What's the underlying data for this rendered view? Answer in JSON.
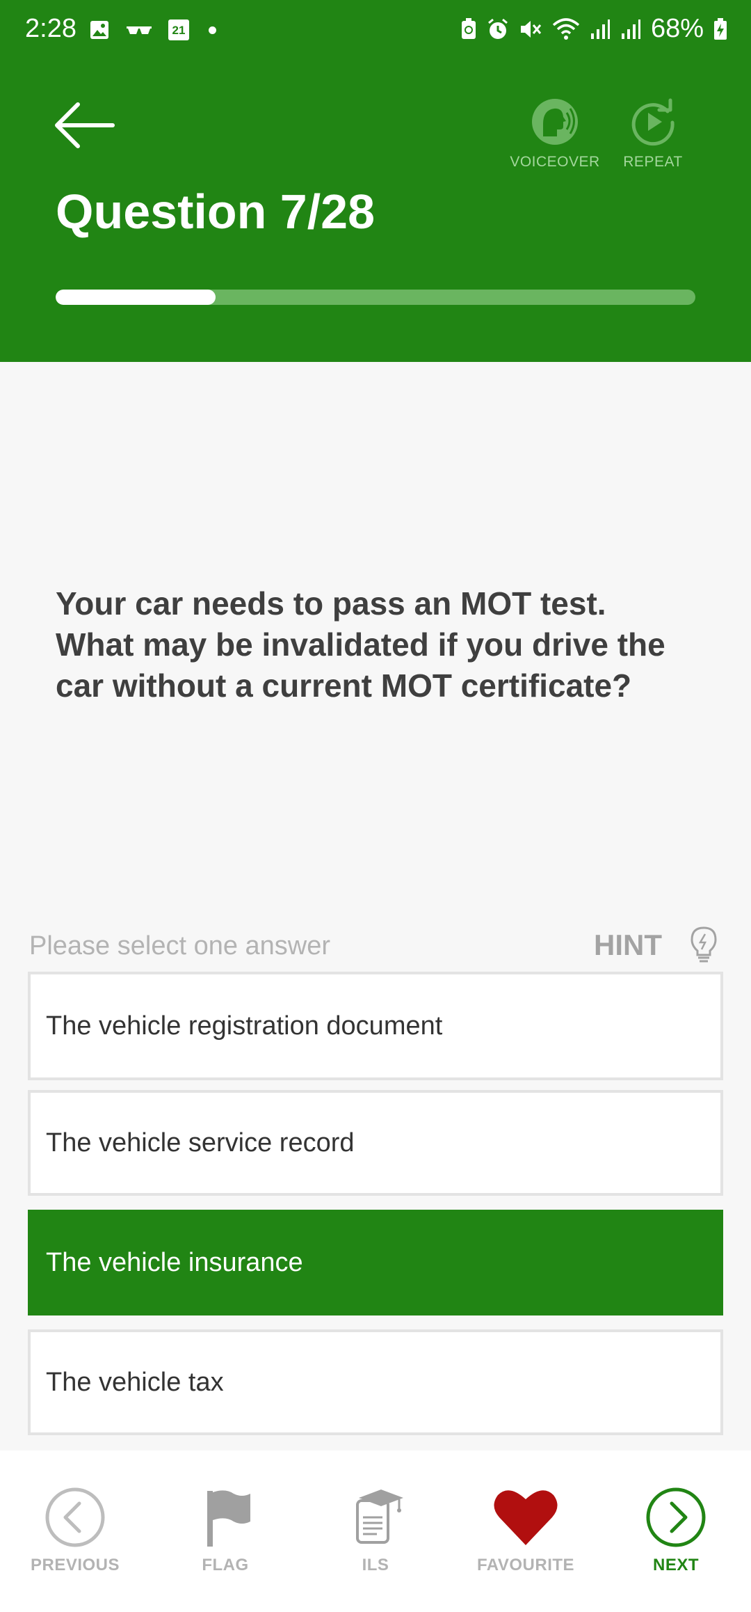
{
  "status_bar": {
    "time": "2:28",
    "calendar_day": "21",
    "battery": "68%"
  },
  "header": {
    "title": "Question 7/28",
    "voiceover_label": "VOICEOVER",
    "repeat_label": "REPEAT",
    "progress_fraction": 0.25
  },
  "question": {
    "text": "Your car needs to pass an MOT test. What may be invalidated if you drive the car without a current MOT certificate?"
  },
  "answers_section": {
    "instruction": "Please select one answer",
    "hint_label": "HINT",
    "options": [
      {
        "label": "The vehicle registration document",
        "selected": false
      },
      {
        "label": "The vehicle service record",
        "selected": false
      },
      {
        "label": "The vehicle insurance",
        "selected": true
      },
      {
        "label": "The vehicle tax",
        "selected": false
      }
    ]
  },
  "bottom_nav": {
    "previous": "PREVIOUS",
    "flag": "FLAG",
    "ils": "ILS",
    "favourite": "FAVOURITE",
    "next": "NEXT"
  },
  "colors": {
    "brand_green": "#218514",
    "favourite_red": "#b10f0f"
  }
}
